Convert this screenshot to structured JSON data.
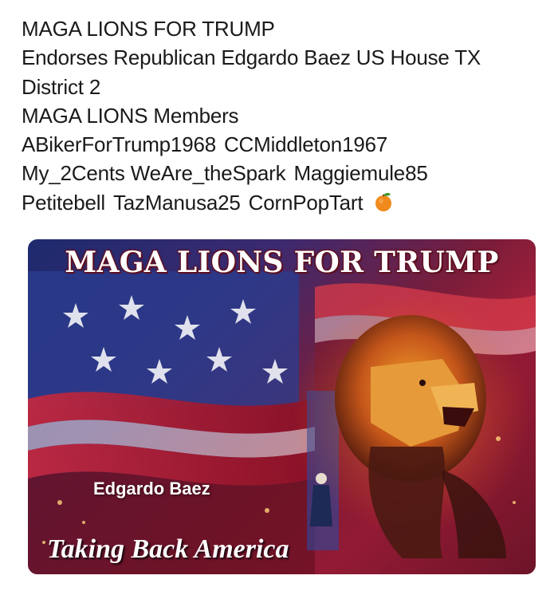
{
  "post": {
    "lines": [
      "MAGA LIONS FOR TRUMP",
      "Endorses Republican Edgardo Baez US House TX",
      "District 2",
      "MAGA LIONS Members"
    ],
    "members_row1": [
      "ABikerForTrump1968",
      "CCMiddleton1967"
    ],
    "members_row2": [
      "My_2Cents WeAre_theSpark",
      "Maggiemule85"
    ],
    "members_row3": [
      "Petitebell",
      "TazManusa25",
      "CornPopTart"
    ],
    "emoji_icon": "tangerine-emoji-icon"
  },
  "banner": {
    "title": "MAGA LIONS FOR TRUMP",
    "candidate_name": "Edgardo Baez",
    "slogan": "Taking Back America"
  },
  "colors": {
    "text": "#1a1a1a",
    "banner_red": "#b8203a",
    "banner_blue": "#1e2a6e",
    "banner_text": "#ffffff"
  }
}
